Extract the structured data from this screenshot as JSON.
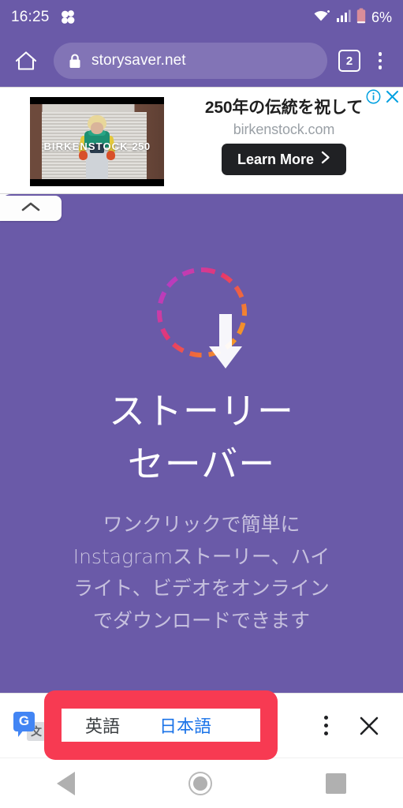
{
  "status_bar": {
    "time": "16:25",
    "app_icon": "clover-icon",
    "wifi_icon": "wifi-icon",
    "signal_icon": "cellular-signal-icon",
    "battery_icon": "battery-low-icon",
    "battery_level": "6%"
  },
  "browser": {
    "home_icon": "home-icon",
    "lock_icon": "lock-icon",
    "url": "storysaver.net",
    "tab_count": "2",
    "overflow_icon": "more-vertical-icon"
  },
  "ad": {
    "image_overlay_brand": "BIRKENSTOCK",
    "image_overlay_number": "250",
    "headline": "250年の伝統を祝して",
    "display_url": "birkenstock.com",
    "cta_label": "Learn More",
    "cta_chevron": "chevron-right-icon",
    "info_icon": "ad-info-icon",
    "close_icon": "ad-close-icon",
    "collapse_icon": "chevron-up-icon"
  },
  "page": {
    "logo_icon": "download-arrow-in-dashed-ring-icon",
    "title_line1": "ストーリー",
    "title_line2": "セーバー",
    "subtitle": "ワンクリックで簡単にInstagramストーリー、ハイライト、ビデオをオンラインでダウンロードできます",
    "background_color": "#6a5aa8"
  },
  "translate_bar": {
    "translate_icon": "google-translate-icon",
    "translate_icon_letter": "G",
    "translate_icon_glyph": "文",
    "source_language": "英語",
    "target_language": "日本語",
    "active_language": "日本語",
    "highlight_color": "#f73a52",
    "active_color": "#1a73e8",
    "overflow_icon": "more-vertical-icon",
    "close_icon": "close-icon"
  },
  "nav_bar": {
    "back_icon": "back-triangle-icon",
    "home_icon": "home-circle-icon",
    "recents_icon": "recents-square-icon"
  }
}
